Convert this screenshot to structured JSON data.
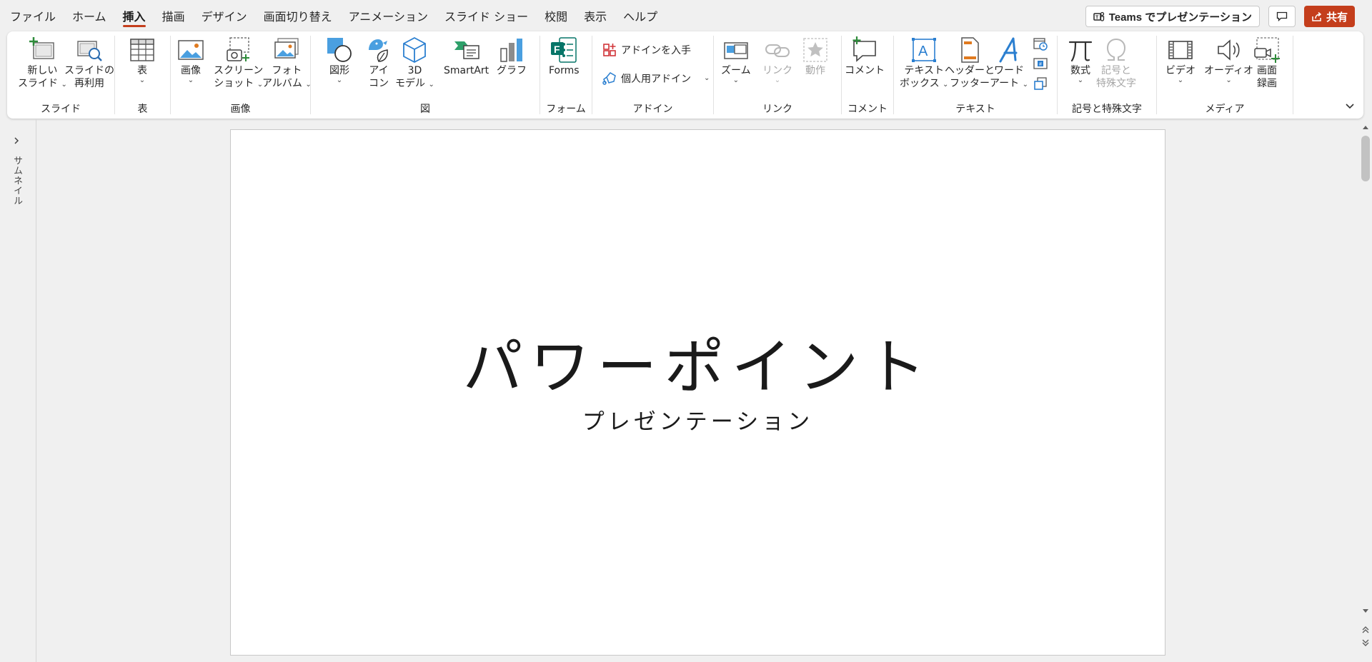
{
  "menu": {
    "tabs": [
      "ファイル",
      "ホーム",
      "挿入",
      "描画",
      "デザイン",
      "画面切り替え",
      "アニメーション",
      "スライド ショー",
      "校閲",
      "表示",
      "ヘルプ"
    ],
    "active_tab": "挿入",
    "teams_label": "Teams でプレゼンテーション",
    "share_label": "共有",
    "accent_color": "#c43e1c"
  },
  "ribbon": {
    "slides": {
      "label": "スライド",
      "new_slide": [
        "新しい",
        "スライド"
      ],
      "reuse": [
        "スライドの",
        "再利用"
      ]
    },
    "tables": {
      "label": "表",
      "table": "表"
    },
    "images": {
      "label": "画像",
      "picture": "画像",
      "screenshot": [
        "スクリーン",
        "ショット"
      ],
      "photo_album": [
        "フォト",
        "アルバム"
      ]
    },
    "illustrations": {
      "label": "図",
      "shapes": "図形",
      "icons": [
        "アイ",
        "コン"
      ],
      "models3d": [
        "3D",
        "モデル"
      ],
      "smartart": "SmartArt",
      "chart": "グラフ"
    },
    "forms": {
      "label": "フォーム",
      "forms": "Forms"
    },
    "addins": {
      "label": "アドイン",
      "get_addins": "アドインを入手",
      "my_addins": "個人用アドイン"
    },
    "links": {
      "label": "リンク",
      "zoom": "ズーム",
      "link": "リンク",
      "action": "動作"
    },
    "comments": {
      "label": "コメント",
      "comment": "コメント"
    },
    "text": {
      "label": "テキスト",
      "textbox": [
        "テキスト",
        "ボックス"
      ],
      "header_footer": [
        "ヘッダーと",
        "フッター"
      ],
      "wordart": [
        "ワード",
        "アート"
      ]
    },
    "symbols": {
      "label": "記号と特殊文字",
      "equation": "数式",
      "symbol": [
        "記号と",
        "特殊文字"
      ]
    },
    "media": {
      "label": "メディア",
      "video": "ビデオ",
      "audio": "オーディオ",
      "screen_recording": [
        "画面",
        "録画"
      ]
    }
  },
  "thumbnail_pane": {
    "label": "サムネイル"
  },
  "slide": {
    "title": "パワーポイント",
    "subtitle": "プレゼンテーション"
  }
}
